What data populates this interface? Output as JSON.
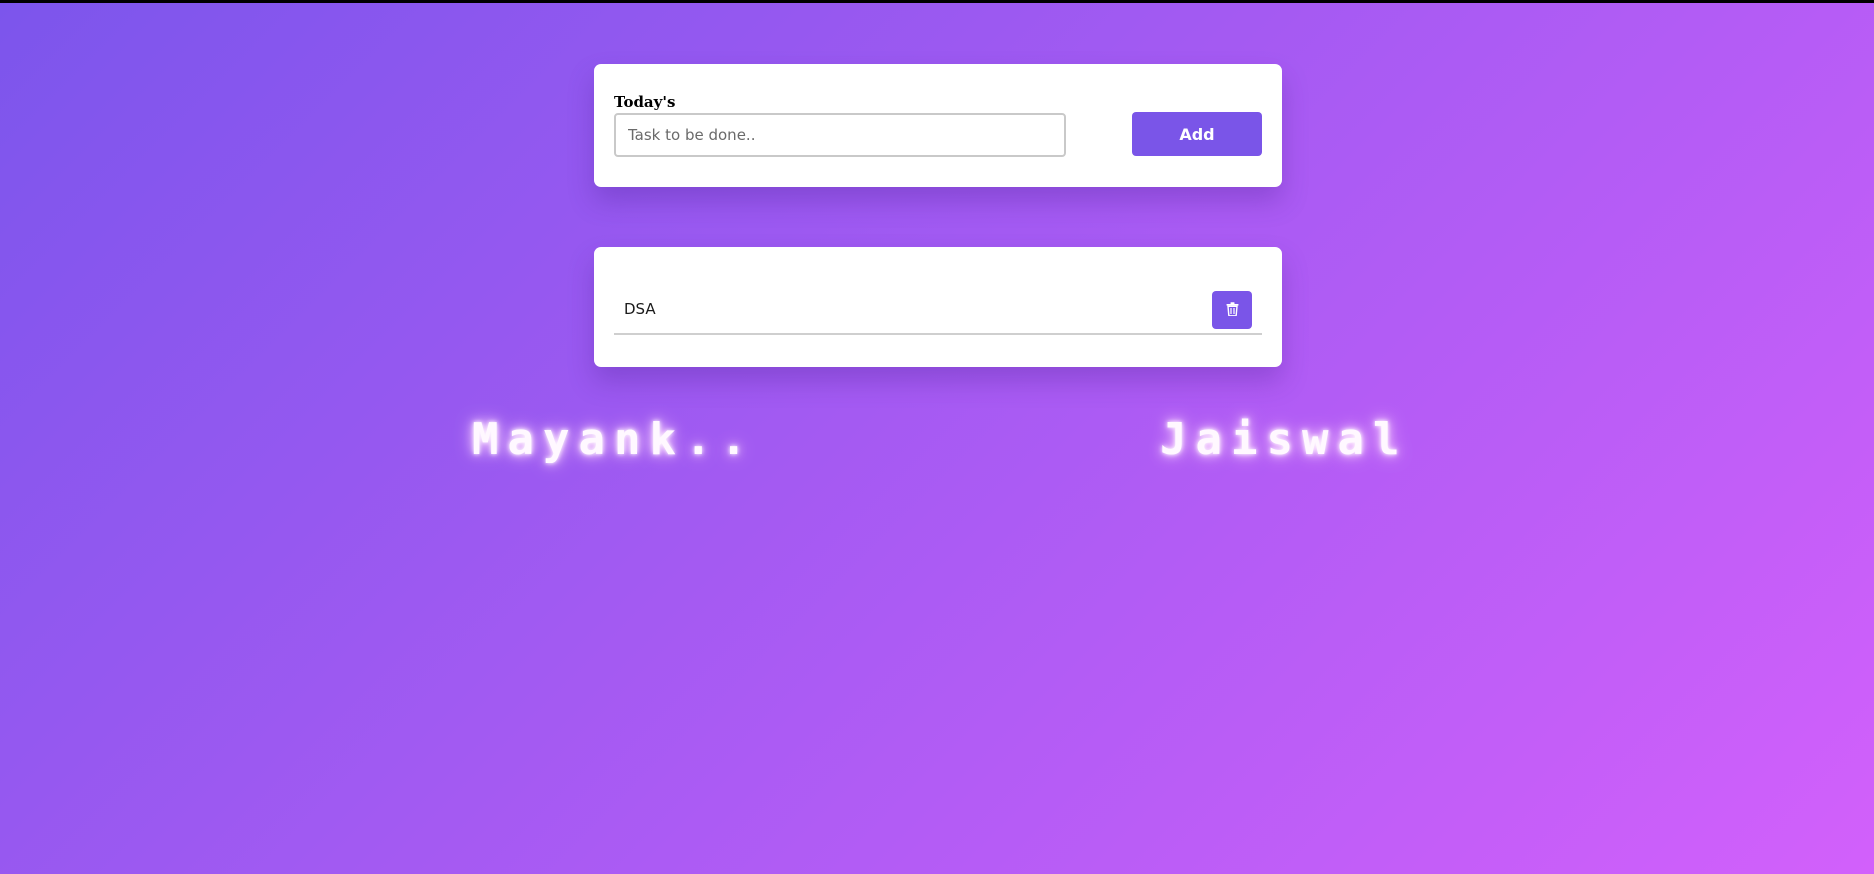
{
  "colors": {
    "background_start": "#7c55ec",
    "background_end": "#d260fb",
    "accent": "#7a55e8",
    "card": "#ffffff",
    "glow_text": "#fff8ff"
  },
  "add_form": {
    "heading": "Today's",
    "input_value": "",
    "input_placeholder": "Task to be done..",
    "add_label": "Add"
  },
  "tasks": [
    {
      "text": "DSA",
      "delete_icon": "trash-icon"
    }
  ],
  "signature": {
    "first": "Mayank..",
    "last": "Jaiswal"
  }
}
